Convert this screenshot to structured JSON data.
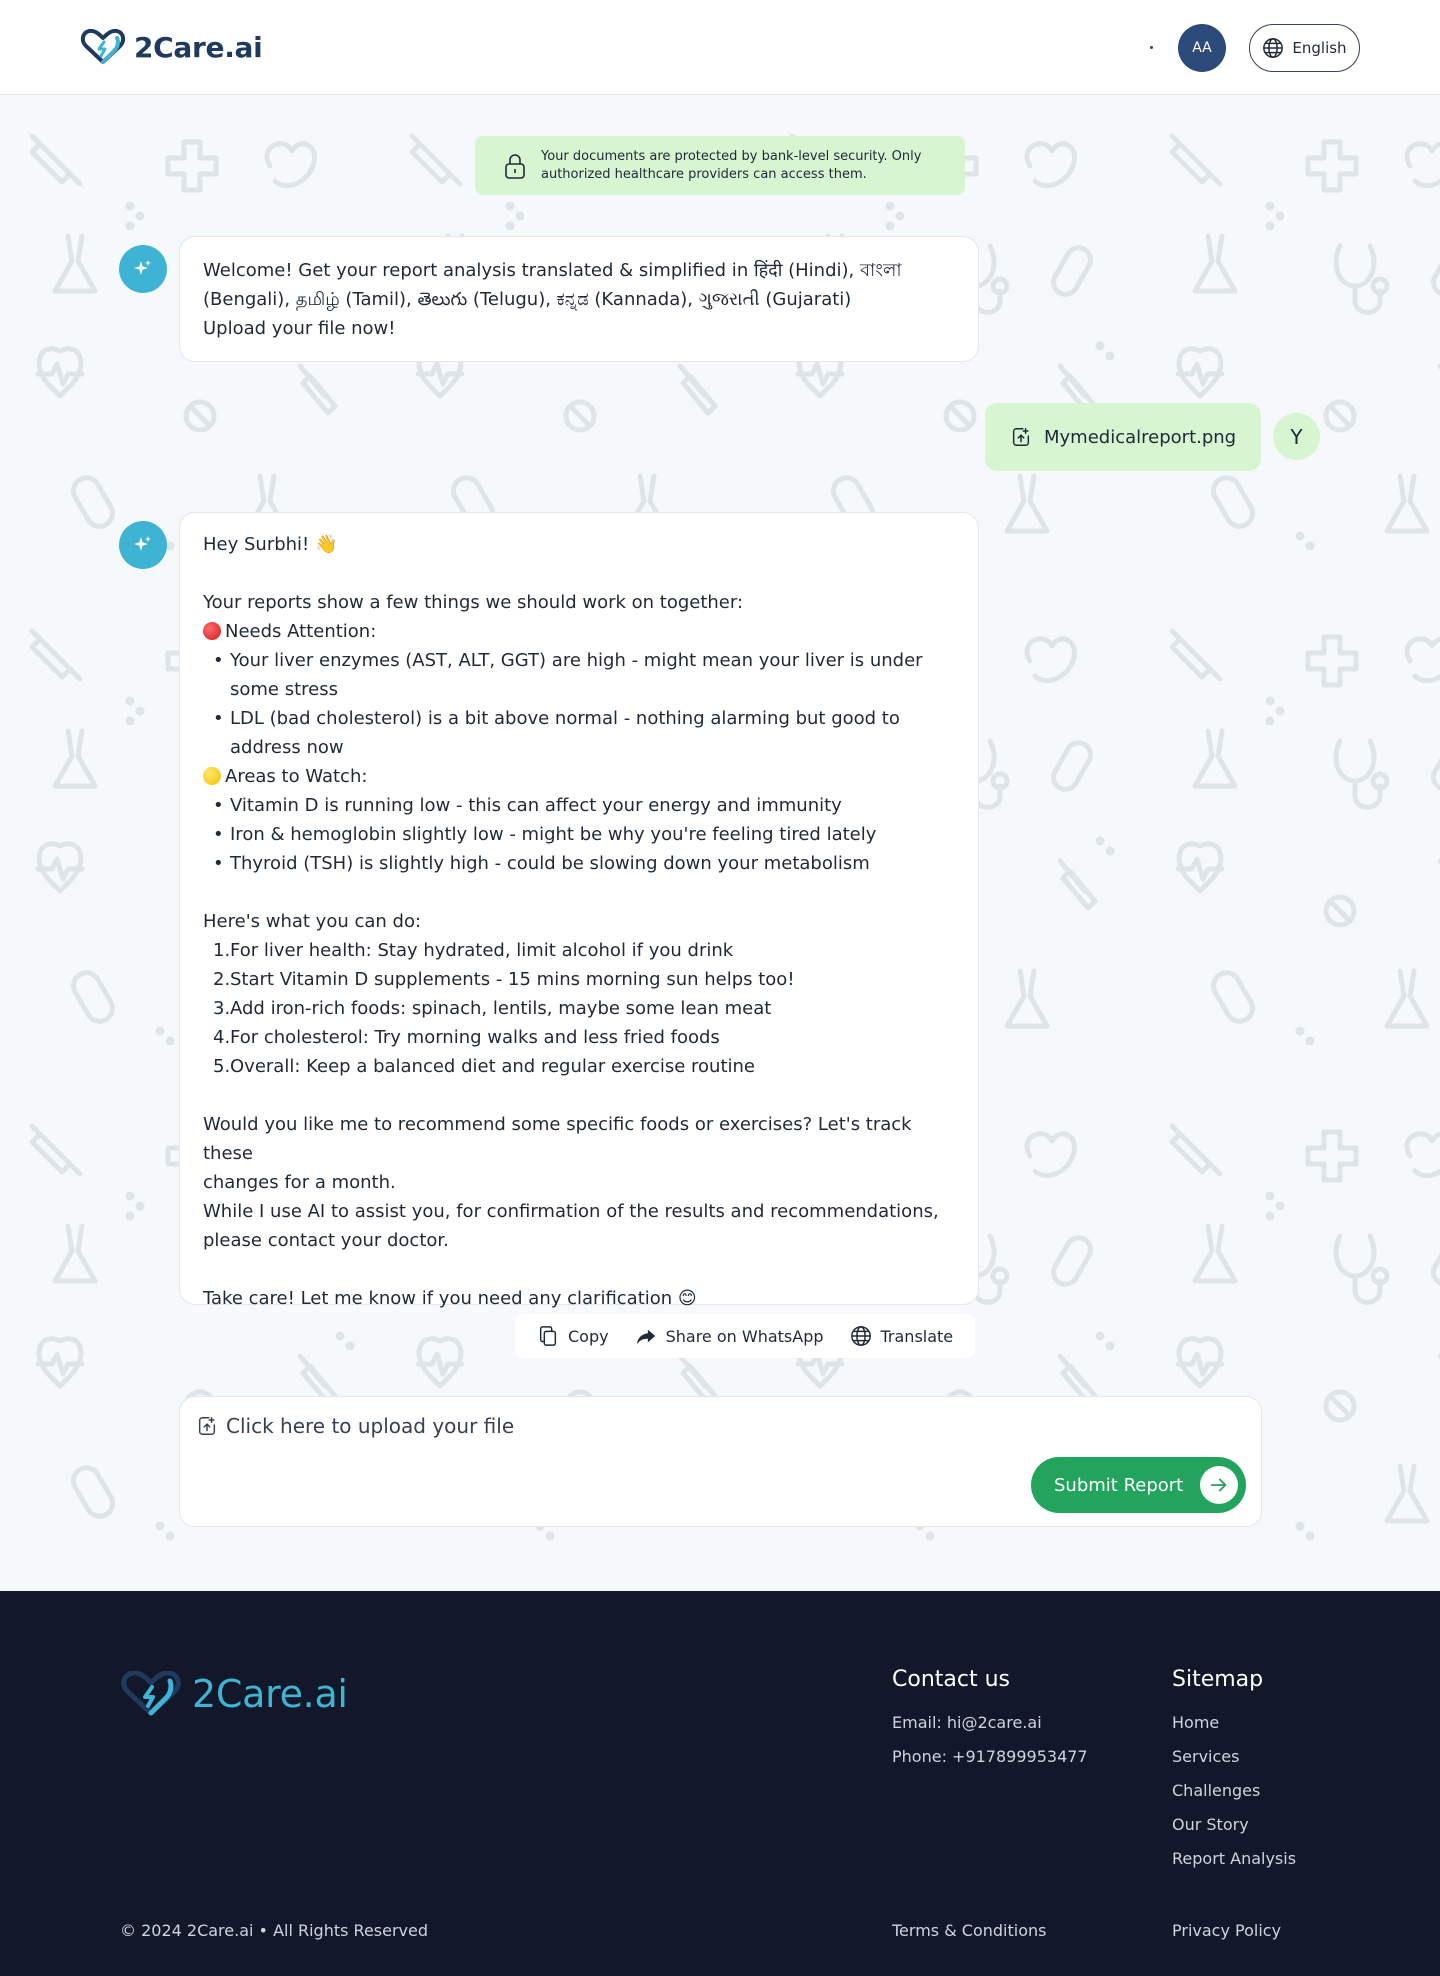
{
  "header": {
    "logo_text": "2Care.ai",
    "avatar_initials": "AA",
    "language_label": "English"
  },
  "security_notice": {
    "line1": "Your documents are protected by bank-level security. Only",
    "line2": "authorized healthcare providers can access them."
  },
  "chat": {
    "welcome": {
      "line1": "Welcome! Get your report analysis translated & simplified in हिंदी (Hindi), বাংলা",
      "line2": "(Bengali), தமிழ் (Tamil), తెలుగు (Telugu), ಕನ್ನಡ (Kannada), ગુજરાતી (Gujarati)",
      "line3": "Upload your file now!"
    },
    "user_file": {
      "filename": "Mymedicalreport.png",
      "avatar_initial": "Y"
    },
    "reply": {
      "greeting": "Hey Surbhi! 👋",
      "intro": "Your reports show a few things we should work on together:",
      "needs_attention_heading": "Needs Attention:",
      "needs_attention_items": [
        [
          "Your liver enzymes (AST, ALT, GGT) are high - might mean your liver is under",
          "some stress"
        ],
        [
          "LDL (bad cholesterol) is a bit above normal - nothing alarming but good to",
          "address now"
        ]
      ],
      "watch_heading": "Areas to Watch:",
      "watch_items": [
        "Vitamin D is running low - this can affect your energy and immunity",
        "Iron & hemoglobin slightly low - might be why you're feeling tired lately",
        "Thyroid (TSH) is slightly high - could be slowing down your metabolism"
      ],
      "todo_heading": "Here's what you can do:",
      "todo_items": [
        "For liver health: Stay hydrated, limit alcohol if you drink",
        "Start Vitamin D supplements - 15 mins morning sun helps too!",
        "Add iron-rich foods: spinach, lentils, maybe some lean meat",
        "For cholesterol: Try morning walks and less fried foods",
        "Overall: Keep a balanced diet and regular exercise routine"
      ],
      "question_line1": "Would you like me to recommend some specific foods or exercises? Let's track these",
      "question_line2": "changes for a month.",
      "disclaimer_line1": "While I use AI to assist you, for confirmation of the results and recommendations,",
      "disclaimer_line2": "please contact your doctor.",
      "closing": "Take care! Let me know if you need any clarification 😊"
    },
    "actions": {
      "copy": "Copy",
      "share": "Share on WhatsApp",
      "translate": "Translate"
    }
  },
  "upload": {
    "prompt": "Click here to upload your file",
    "submit_label": "Submit Report"
  },
  "footer": {
    "logo_text": "2Care.ai",
    "contact_heading": "Contact us",
    "email": "Email: hi@2care.ai",
    "phone": "Phone: +917899953477",
    "sitemap_heading": "Sitemap",
    "sitemap_links": [
      "Home",
      "Services",
      "Challenges",
      "Our Story",
      "Report Analysis"
    ],
    "copyright": "© 2024 2Care.ai • All Rights Reserved",
    "terms": "Terms & Conditions",
    "privacy": "Privacy Policy"
  },
  "colors": {
    "brand_teal": "#3fb3d3",
    "brand_navy": "#1e3a5f",
    "user_bubble": "#d6f5d0",
    "submit_green": "#22a45d",
    "footer_bg": "#121829"
  }
}
